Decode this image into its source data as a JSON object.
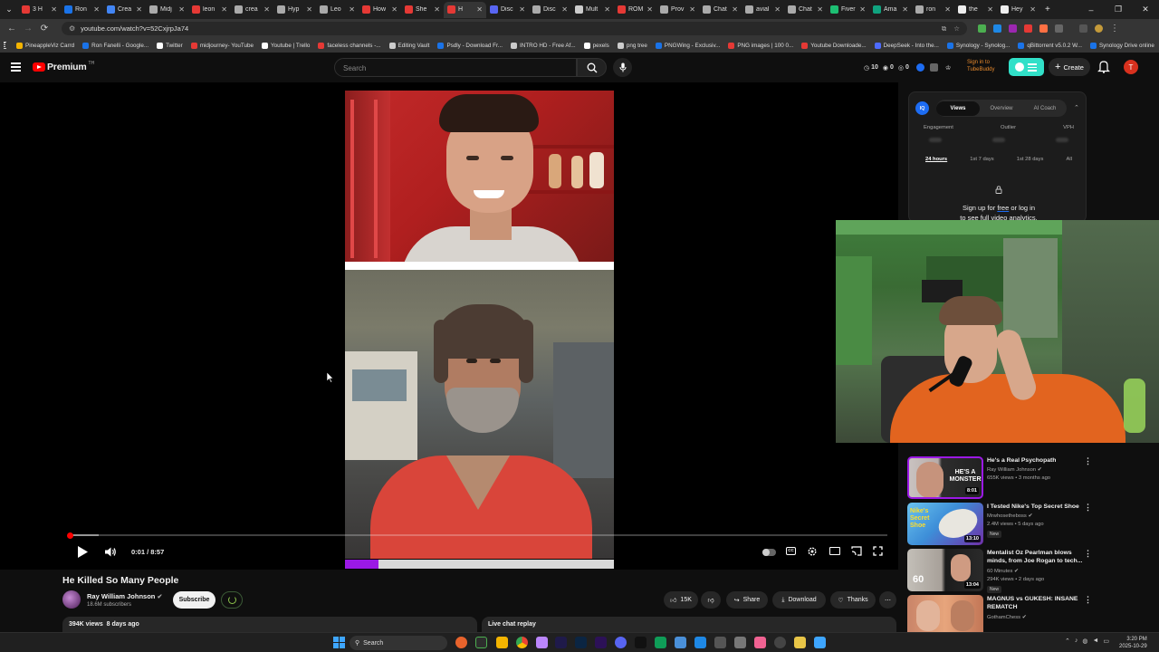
{
  "browser": {
    "tabs": [
      {
        "label": "3 H",
        "color": "#e53935"
      },
      {
        "label": "Ron",
        "color": "#1a73e8"
      },
      {
        "label": "Crea",
        "color": "#4285f4"
      },
      {
        "label": "Midj",
        "color": "#aaaaaa"
      },
      {
        "label": "leon",
        "color": "#e53935"
      },
      {
        "label": "crea",
        "color": "#aaaaaa"
      },
      {
        "label": "Hyp",
        "color": "#aaaaaa"
      },
      {
        "label": "Leo",
        "color": "#aaaaaa"
      },
      {
        "label": "How",
        "color": "#e53935"
      },
      {
        "label": "She",
        "color": "#e53935"
      },
      {
        "label": "H",
        "color": "#e53935"
      },
      {
        "label": "Disc",
        "color": "#5865f2"
      },
      {
        "label": "Disc",
        "color": "#aaaaaa"
      },
      {
        "label": "Mult",
        "color": "#cccccc"
      },
      {
        "label": "ROM",
        "color": "#e53935"
      },
      {
        "label": "Prov",
        "color": "#aaaaaa"
      },
      {
        "label": "Chat",
        "color": "#aaaaaa"
      },
      {
        "label": "avial",
        "color": "#aaaaaa"
      },
      {
        "label": "Chat",
        "color": "#aaaaaa"
      },
      {
        "label": "Fiver",
        "color": "#1dbf73"
      },
      {
        "label": "Ama",
        "color": "#10a37f"
      },
      {
        "label": "ron",
        "color": "#aaaaaa"
      },
      {
        "label": "the",
        "color": "#eeeeee"
      },
      {
        "label": "Hey",
        "color": "#eeeeee"
      }
    ],
    "active_tab_index": 10,
    "new_tab": "+",
    "window_controls": [
      "–",
      "❐",
      "✕"
    ],
    "url": "youtube.com/watch?v=52CxjrpJa74",
    "bookmarks": [
      {
        "label": "PineappleViz Carrd",
        "color": "#f4b400"
      },
      {
        "label": "Ron Fanelli - Google...",
        "color": "#1a73e8"
      },
      {
        "label": "Twitter",
        "color": "#ffffff"
      },
      {
        "label": "midjourney- YouTube",
        "color": "#e53935"
      },
      {
        "label": "Youtube | Trello",
        "color": "#ffffff"
      },
      {
        "label": "faceless channels -...",
        "color": "#e53935"
      },
      {
        "label": "Editing Vault",
        "color": "#cccccc"
      },
      {
        "label": "Psdly - Download Fr...",
        "color": "#1a73e8"
      },
      {
        "label": "INTRO HD - Free Af...",
        "color": "#cccccc"
      },
      {
        "label": "pexels",
        "color": "#ffffff"
      },
      {
        "label": "png tree",
        "color": "#cccccc"
      },
      {
        "label": "PNGWing - Exclusiv...",
        "color": "#1a73e8"
      },
      {
        "label": "PNG images | 100 0...",
        "color": "#e53935"
      },
      {
        "label": "Youtube Downloade...",
        "color": "#e53935"
      },
      {
        "label": "DeepSeek - Into the...",
        "color": "#4d6bfe"
      },
      {
        "label": "Synology - Synolog...",
        "color": "#1a73e8"
      },
      {
        "label": "qBittorrent v5.0.2 W...",
        "color": "#1a73e8"
      },
      {
        "label": "Synology Drive online",
        "color": "#1a73e8"
      }
    ]
  },
  "youtube_header": {
    "logo_text": "Premium",
    "country": "TH",
    "search_placeholder": "Search",
    "stat_views": "10",
    "stat_a": "0",
    "stat_b": "0",
    "tubebuddy_text_1": "Sign in to",
    "tubebuddy_text_2": "TubeBuddy",
    "create_label": "Create",
    "avatar_letter": "T"
  },
  "player": {
    "time": "0:01 / 8:57",
    "played_fraction": 0.002,
    "inner_progress_fraction": 0.125
  },
  "video": {
    "title": "He Killed So Many People",
    "channel": "Ray William Johnson",
    "subscribers": "18.6M subscribers",
    "subscribe_label": "Subscribe",
    "likes": "15K",
    "share_label": "Share",
    "download_label": "Download",
    "thanks_label": "Thanks",
    "views_date": "394K views  8 days ago",
    "live_chat_label": "Live chat replay"
  },
  "vidiq": {
    "logo": "IQ",
    "tabs": [
      "Views",
      "Overview",
      "AI Coach"
    ],
    "active_tab": 0,
    "metrics": [
      "Engagement",
      "Outlier",
      "VPH"
    ],
    "ranges": [
      "24 hours",
      "1st 7 days",
      "1st 28 days",
      "All"
    ],
    "active_range": 0,
    "signup_line1_a": "Sign up for ",
    "signup_line1_link": "free",
    "signup_line1_b": " or log in",
    "signup_line2": "to see full video analytics."
  },
  "recommendations": [
    {
      "title": "He's a Real Psychopath",
      "channel": "Ray William Johnson",
      "meta": "655K views • 3 months ago",
      "duration": "8:01",
      "thumb_text": "HE'S A MONSTER",
      "badge": ""
    },
    {
      "title": "I Tested Nike's Top Secret Shoe",
      "channel": "Mrwhosetheboss",
      "meta": "2.4M views • 5 days ago",
      "duration": "13:10",
      "thumb_text": "Nike's Secret Shoe",
      "badge": "New"
    },
    {
      "title": "Mentalist Oz Pearlman blows minds, from Joe Rogan to tech...",
      "channel": "60 Minutes",
      "meta": "294K views • 2 days ago",
      "duration": "13:04",
      "thumb_text": "60",
      "badge": "New"
    },
    {
      "title": "MAGNUS vs GUKESH: INSANE REMATCH",
      "channel": "GothamChess",
      "meta": "",
      "duration": "",
      "thumb_text": "",
      "badge": ""
    }
  ],
  "taskbar": {
    "search_label": "Search",
    "time": "3:20 PM",
    "date": "2025-10-29"
  }
}
